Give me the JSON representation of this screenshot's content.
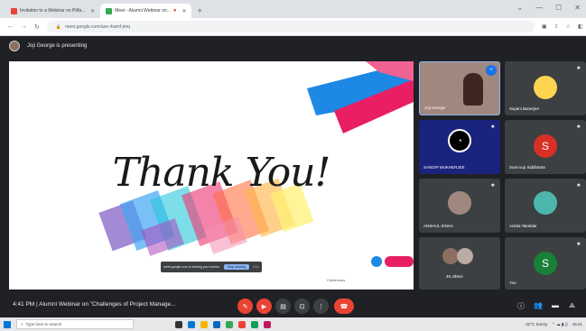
{
  "browser": {
    "tabs": [
      {
        "title": "Invitation to a Webinar on Pitfa...",
        "favicon_color": "#ea4335"
      },
      {
        "title": "Meet - Alumni Webinar on...",
        "favicon_color": "#34a853"
      }
    ],
    "url": "meet.google.com/ase-rkamf-jmq"
  },
  "meet": {
    "presenting_text": "Joji George is presenting",
    "slide": {
      "headline": "Thank You!",
      "share_banner": {
        "message": "meet.google.com is sharing your screen.",
        "stop_label": "Stop sharing",
        "hide_label": "Hide"
      },
      "footer_text": "Continuous"
    },
    "participants": [
      {
        "name": "Joji George",
        "avatar_letter": "",
        "color": "#6d4c41"
      },
      {
        "name": "Sayani Banerjee",
        "avatar_letter": "",
        "color": "#ffd54f"
      },
      {
        "name": "SANDIP MUKHERJEE",
        "avatar_letter": "",
        "color": "#1a237e"
      },
      {
        "name": "Sumroop Siddhanta",
        "avatar_letter": "S",
        "color": "#d93025"
      },
      {
        "name": "ANSHUL SINHA",
        "avatar_letter": "",
        "color": "#a1887f"
      },
      {
        "name": "Ankita Talukdar",
        "avatar_letter": "",
        "color": "#4db6ac"
      },
      {
        "name": "46 others",
        "avatar_letter": "",
        "color": "#8d6e63"
      },
      {
        "name": "You",
        "avatar_letter": "S",
        "color": "#188038"
      }
    ],
    "meeting_info": "4:41 PM  |  Alumni Webinar on \"Challenges of Project Manage...",
    "controls": {
      "mic_icon": "mic-off-icon",
      "camera_icon": "camera-off-icon",
      "captions_icon": "captions-icon",
      "present_icon": "present-icon",
      "more_icon": "more-vert-icon",
      "end_icon": "call-end-icon"
    }
  },
  "taskbar": {
    "search_placeholder": "Type here to search",
    "weather": "32°C Sunny",
    "time": "16:41"
  },
  "colors": {
    "meet_bg": "#202124",
    "tile_bg": "#3c4043",
    "danger": "#ea4335",
    "accent_blue": "#8ab4f8"
  }
}
